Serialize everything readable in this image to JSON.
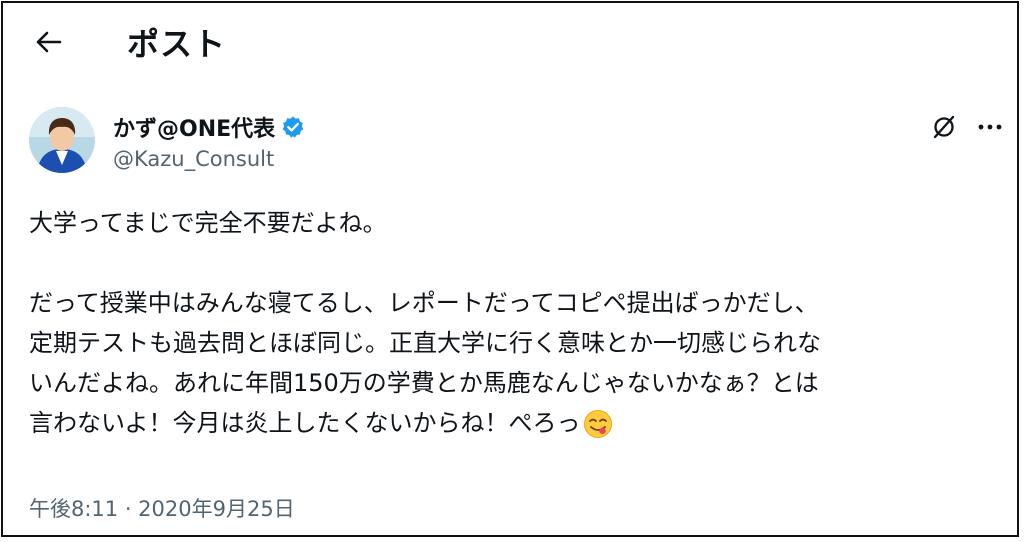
{
  "header": {
    "back_icon": "arrow-left-icon",
    "title": "ポスト"
  },
  "author": {
    "display_name": "かず@ONE代表",
    "handle": "@Kazu_Consult",
    "verified_color": "#1d9bf0"
  },
  "actions": {
    "grok_icon": "grok-icon",
    "more_icon": "more-dots-icon"
  },
  "tweet": {
    "paragraph1": "大学ってまじで完全不要だよね。",
    "line2": "だって授業中はみんな寝てるし、レポートだってコピペ提出ばっかだし、",
    "line3": "定期テストも過去問とほぼ同じ。正直大学に行く意味とか一切感じられな",
    "line4": "いんだよね。あれに年間150万の学費とか馬鹿なんじゃないかなぁ？とは",
    "line5": "言わないよ！今月は炎上したくないからね！ぺろっ",
    "emoji": "face-savoring-food-emoji"
  },
  "timestamp": "午後8:11 · 2020年9月25日"
}
